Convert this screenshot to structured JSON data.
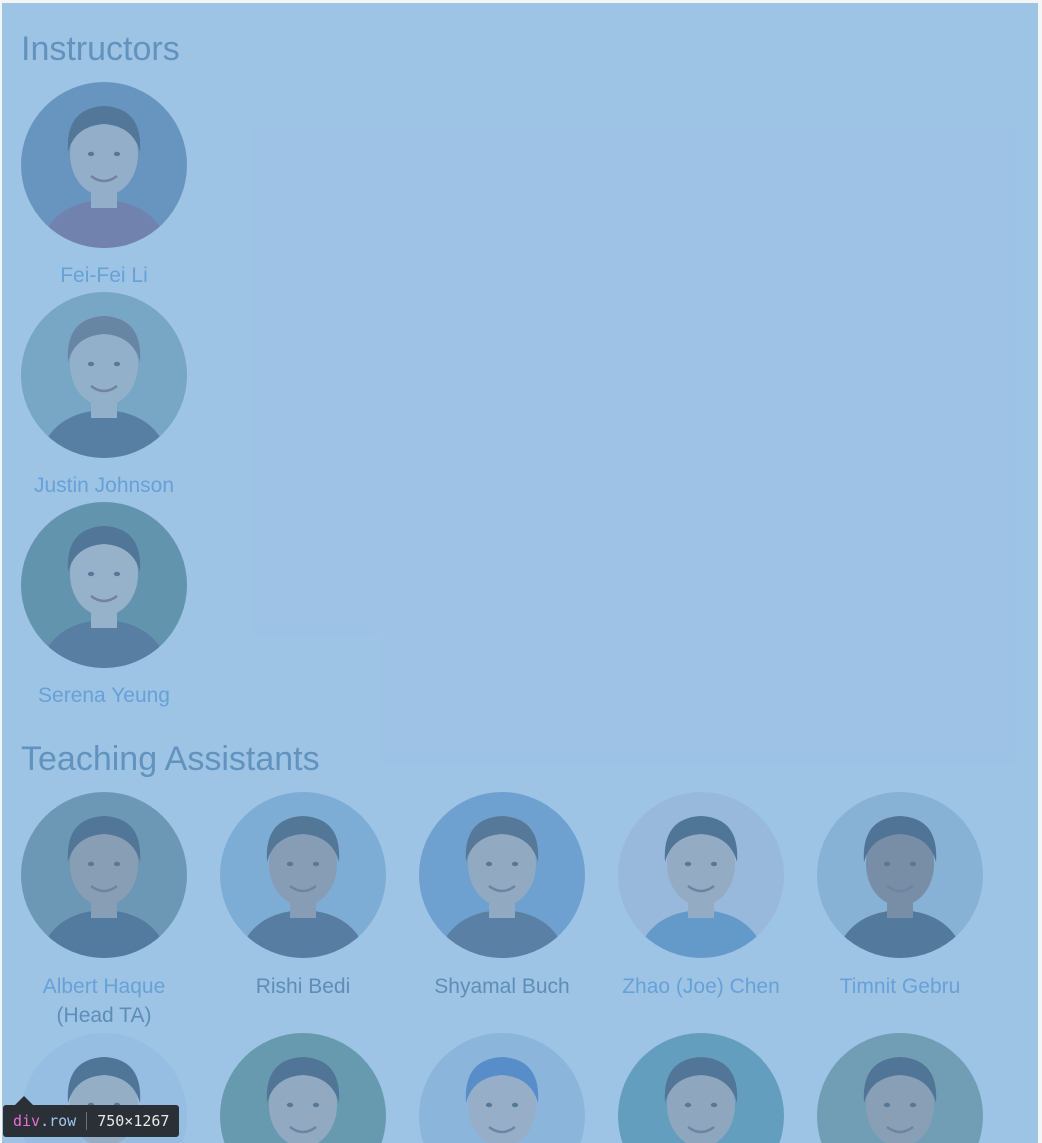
{
  "sections": {
    "instructors": {
      "heading": "Instructors",
      "people": [
        {
          "name": "Fei-Fei Li",
          "linked": true,
          "bg": "#5a6f8a",
          "skin": "#d9b8a0",
          "hair": "#1d1a1a",
          "shirt": "#7a3a5a"
        },
        {
          "name": "Justin Johnson",
          "linked": true,
          "bg": "#8aa09a",
          "skin": "#d8bfa8",
          "hair": "#5a4535",
          "shirt": "#2a3038"
        },
        {
          "name": "Serena Yeung",
          "linked": true,
          "bg": "#4e6d55",
          "skin": "#e2c2a6",
          "hair": "#1a1514",
          "shirt": "#2e2e34"
        }
      ]
    },
    "tas": {
      "heading": "Teaching Assistants",
      "people": [
        {
          "name": "Albert Haque",
          "role": "(Head TA)",
          "linked": true,
          "bg": "#6a7a6a",
          "skin": "#b88a6a",
          "hair": "#1a1614",
          "shirt": "#1f242c"
        },
        {
          "name": "Rishi Bedi",
          "linked": false,
          "bg": "#9ab6c8",
          "skin": "#b4876a",
          "hair": "#1e1814",
          "shirt": "#2a2d33"
        },
        {
          "name": "Shyamal Buch",
          "linked": false,
          "bg": "#6d94b8",
          "skin": "#d4ad90",
          "hair": "#2a1e18",
          "shirt": "#32363c"
        },
        {
          "name": "Zhao (Joe) Chen",
          "linked": true,
          "bg": "#e6dad8",
          "skin": "#d9b394",
          "hair": "#141212",
          "shirt": "#4e7fa8"
        },
        {
          "name": "Timnit Gebru",
          "linked": true,
          "bg": "#b7c0c8",
          "skin": "#8a5a3e",
          "hair": "#15110f",
          "shirt": "#1e1e22"
        }
      ],
      "second_row": [
        {
          "bg": "#dfe6ec",
          "skin": "#d8b89a",
          "hair": "#141212",
          "shirt": "#2a2d33"
        },
        {
          "bg": "#5b7f5a",
          "skin": "#d2ad8e",
          "hair": "#161313",
          "shirt": "#2a2d33"
        },
        {
          "bg": "#c0ccd6",
          "skin": "#e0b9a0",
          "hair": "#2b5ba8",
          "shirt": "#2a2d33"
        },
        {
          "bg": "#4f8a86",
          "skin": "#c9a184",
          "hair": "#1c1614",
          "shirt": "#2a2d33"
        },
        {
          "bg": "#7a8a6a",
          "skin": "#b88c6c",
          "hair": "#151212",
          "shirt": "#2a2d33"
        }
      ]
    }
  },
  "inspector": {
    "tag": "div",
    "class": ".row",
    "size": "750×1267"
  }
}
